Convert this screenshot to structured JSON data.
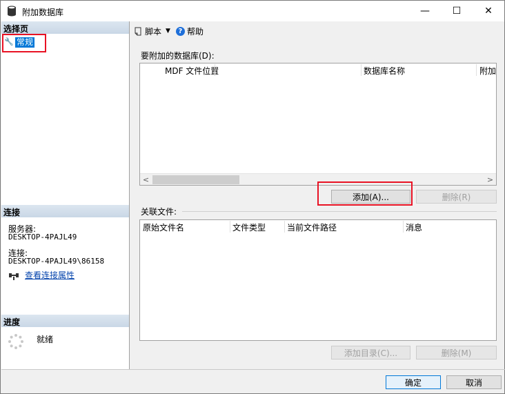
{
  "window": {
    "title": "附加数据库",
    "minimize": "—",
    "maximize": "☐",
    "close": "✕"
  },
  "left_pane": {
    "select_page_header": "选择页",
    "pages": [
      {
        "label": "常规",
        "icon": "wrench-icon"
      }
    ],
    "connection_header": "连接",
    "server_label": "服务器:",
    "server_value": "DESKTOP-4PAJL49",
    "connection_label": "连接:",
    "connection_value": "DESKTOP-4PAJL49\\86158",
    "view_connection_link": "查看连接属性",
    "progress_header": "进度",
    "progress_status": "就绪"
  },
  "toolbar": {
    "script_label": "脚本",
    "help_label": "帮助"
  },
  "databases": {
    "group_label": "要附加的数据库(D):",
    "columns": [
      "MDF 文件位置",
      "数据库名称",
      "附加"
    ],
    "add_button": "添加(A)...",
    "remove_button": "删除(R)"
  },
  "related_files": {
    "group_label": "关联文件:",
    "columns": [
      "原始文件名",
      "文件类型",
      "当前文件路径",
      "消息"
    ],
    "add_catalog_button": "添加目录(C)...",
    "remove_button": "删除(M)"
  },
  "footer": {
    "ok_button": "确定",
    "cancel_button": "取消"
  },
  "colors": {
    "highlight": "#e81123",
    "selection": "#0078d7"
  }
}
